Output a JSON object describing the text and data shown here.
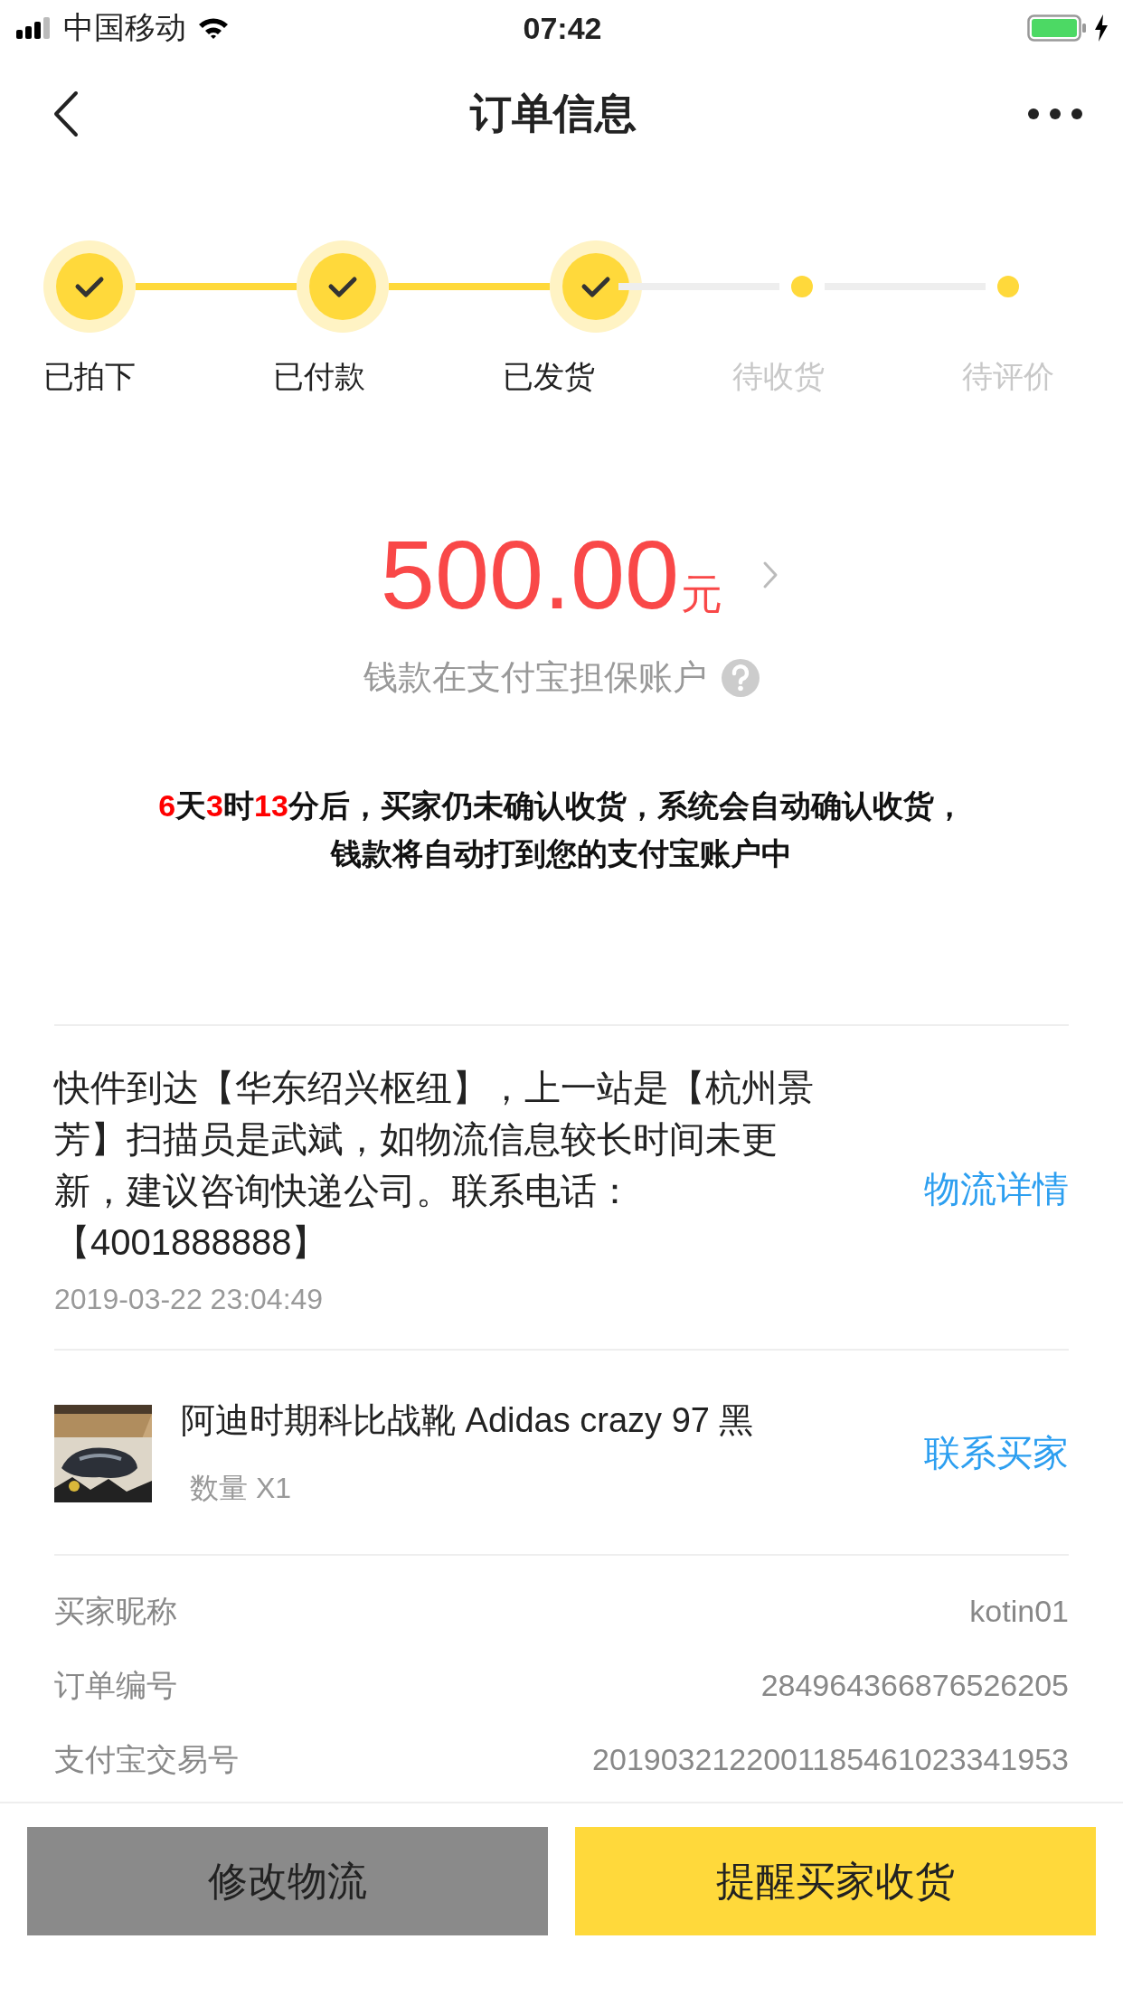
{
  "status_bar": {
    "carrier": "中国移动",
    "time": "07:42"
  },
  "nav": {
    "title": "订单信息"
  },
  "steps": [
    {
      "label": "已拍下",
      "done": true
    },
    {
      "label": "已付款",
      "done": true
    },
    {
      "label": "已发货",
      "done": true
    },
    {
      "label": "待收货",
      "done": false
    },
    {
      "label": "待评价",
      "done": false
    }
  ],
  "amount": {
    "value": "500.00",
    "unit": "元",
    "note": "钱款在支付宝担保账户"
  },
  "countdown": [
    [
      {
        "text": "6",
        "highlight": true
      },
      {
        "text": "天",
        "highlight": false
      },
      {
        "text": "3",
        "highlight": true
      },
      {
        "text": "时",
        "highlight": false
      },
      {
        "text": "13",
        "highlight": true
      },
      {
        "text": "分后，买家仍未确认收货，系统会自动确认收货，",
        "highlight": false
      }
    ],
    [
      {
        "text": "钱款将自动打到您的支付宝账户中",
        "highlight": false
      }
    ]
  ],
  "logistics": {
    "message": "快件到达【华东绍兴枢纽】，上一站是【杭州景芳】扫描员是武斌，如物流信息较长时间未更新，建议咨询快递公司。联系电话：【4001888888】",
    "time": "2019-03-22 23:04:49",
    "link": "物流详情"
  },
  "product": {
    "title": "阿迪时期科比战靴 Adidas crazy 97 黑",
    "quantity": "数量 X1",
    "link": "联系买家"
  },
  "details": [
    {
      "label": "买家昵称",
      "value": "kotin01"
    },
    {
      "label": "订单编号",
      "value": "284964366876526205"
    },
    {
      "label": "支付宝交易号",
      "value": "2019032122001185461023341953"
    }
  ],
  "buttons": [
    {
      "label": "修改物流",
      "kind": "secondary"
    },
    {
      "label": "提醒买家收货",
      "kind": "primary"
    }
  ]
}
